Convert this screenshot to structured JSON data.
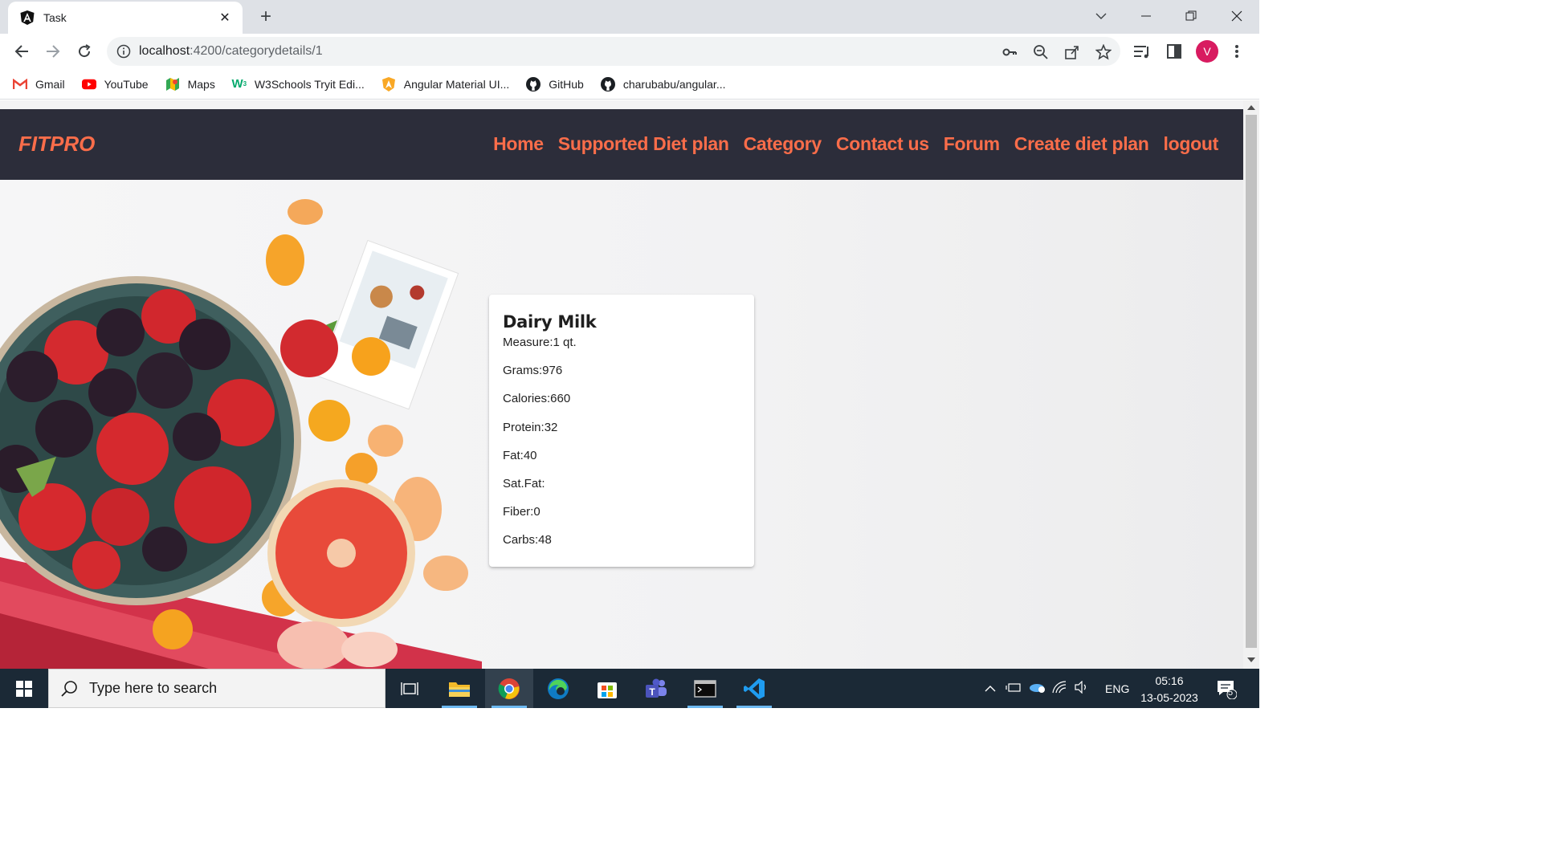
{
  "browser": {
    "tab_title": "Task",
    "url_host": "localhost",
    "url_path": ":4200/categorydetails/1",
    "avatar_letter": "V",
    "bookmarks": [
      {
        "label": "Gmail",
        "icon": "gmail-icon"
      },
      {
        "label": "YouTube",
        "icon": "youtube-icon"
      },
      {
        "label": "Maps",
        "icon": "maps-icon"
      },
      {
        "label": "W3Schools Tryit Edi...",
        "icon": "w3schools-icon"
      },
      {
        "label": "Angular Material UI...",
        "icon": "angular-material-icon"
      },
      {
        "label": "GitHub",
        "icon": "github-icon"
      },
      {
        "label": "charubabu/angular...",
        "icon": "github-icon"
      }
    ]
  },
  "site": {
    "brand": "FITPRO",
    "nav": [
      "Home",
      "Supported Diet plan",
      "Category",
      "Contact us",
      "Forum",
      "Create diet plan",
      "logout"
    ],
    "accent_color": "#fa6d4a",
    "navbar_color": "#2c2d3a"
  },
  "card": {
    "title": "Dairy Milk",
    "rows": [
      "Measure:1 qt.",
      "Grams:976",
      "Calories:660",
      "Protein:32",
      "Fat:40",
      "Sat.Fat:",
      "Fiber:0",
      "Carbs:48"
    ]
  },
  "taskbar": {
    "search_placeholder": "Type here to search",
    "language": "ENG",
    "time": "05:16",
    "date": "13-05-2023",
    "notification_count": "5"
  }
}
